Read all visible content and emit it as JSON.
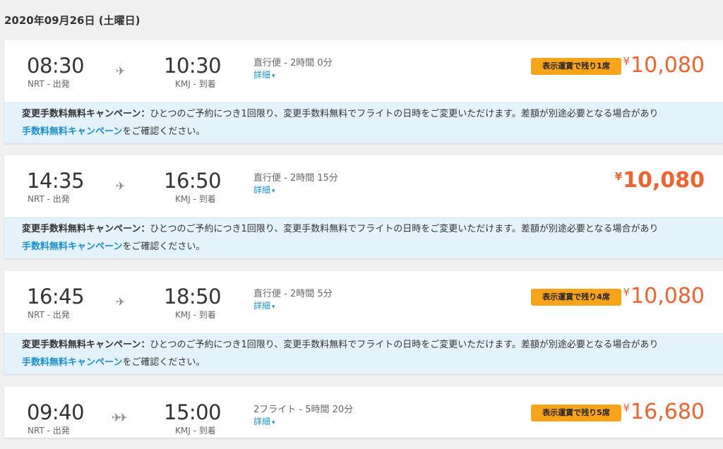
{
  "date_header": "2020年09月26日 (土曜日)",
  "campaign": {
    "title": "変更手数料無料キャンペーン：",
    "text": "ひとつのご予約につき1回限り、変更手数料無料でフライトの日時をご変更いただけます。差額が別途必要となる場合があり",
    "link": "手数料無料キャンペーン",
    "tail": "をご確認ください。"
  },
  "flights": [
    {
      "dep_time": "08:30",
      "dep_label": "NRT - 出発",
      "arr_time": "10:30",
      "arr_label": "KMJ - 到着",
      "info": "直行便 - 2時間 0分",
      "details": "詳細",
      "badge": "表示運賃で残り1席",
      "currency": "¥",
      "price": "10,080",
      "plane_icon": "plane-icon"
    },
    {
      "dep_time": "14:35",
      "dep_label": "NRT - 出発",
      "arr_time": "16:50",
      "arr_label": "KMJ - 到着",
      "info": "直行便 - 2時間 15分",
      "details": "詳細",
      "currency": "¥",
      "price": "10,080",
      "plane_icon": "plane-icon"
    },
    {
      "dep_time": "16:45",
      "dep_label": "NRT - 出発",
      "arr_time": "18:50",
      "arr_label": "KMJ - 到着",
      "info": "直行便 - 2時間 5分",
      "details": "詳細",
      "badge": "表示運賃で残り4席",
      "currency": "¥",
      "price": "10,080",
      "plane_icon": "plane-icon"
    },
    {
      "dep_time": "09:40",
      "dep_label": "NRT - 出発",
      "arr_time": "15:00",
      "arr_label": "KMJ - 到着",
      "info": "2フライト - 5時間 20分",
      "details": "詳細",
      "badge": "表示運賃で残り5席",
      "currency": "¥",
      "price": "16,680",
      "plane_icon": "two-planes-icon"
    }
  ],
  "colors": {
    "price": "#f2622e",
    "badge": "#f7a41a",
    "link": "#1a8fd6",
    "campaign_bg": "#e3f2fb"
  }
}
